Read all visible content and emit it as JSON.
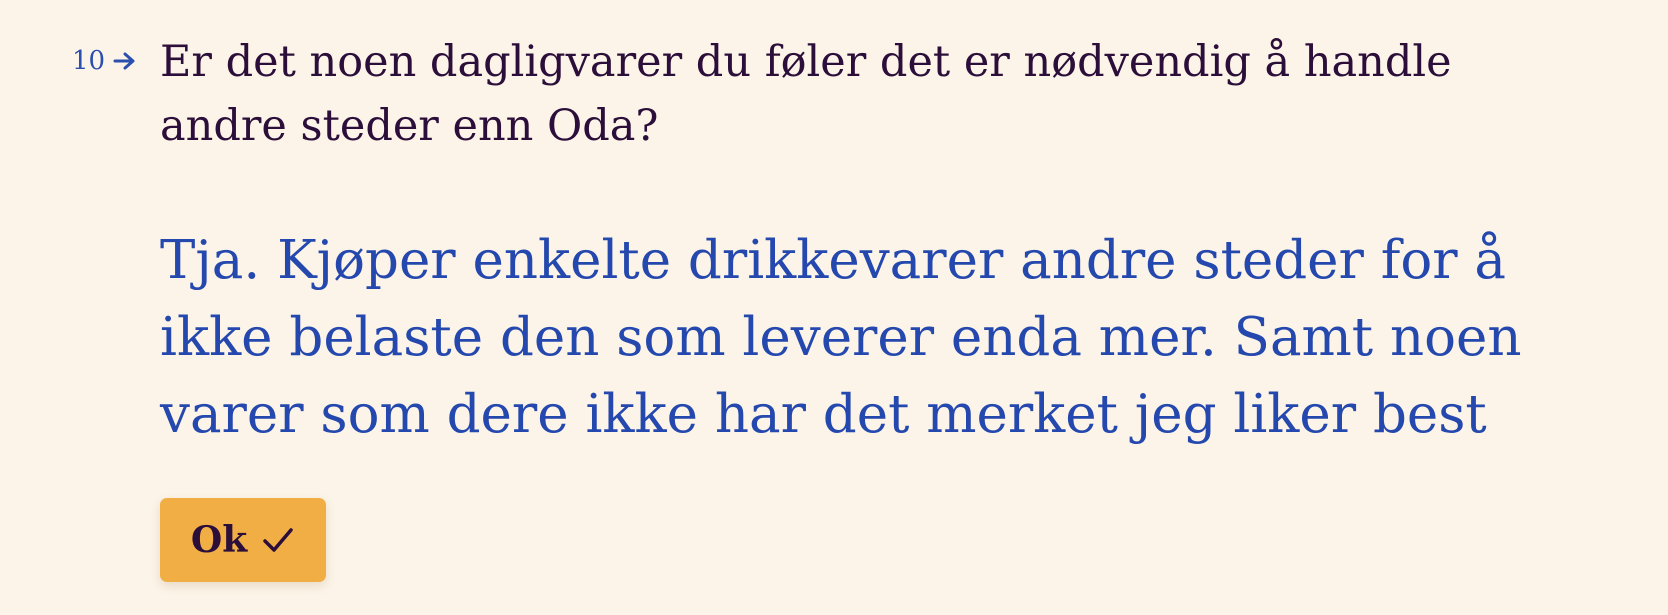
{
  "question": {
    "number": "10",
    "text": "Er det noen dagligvarer du føler det er nødvendig å handle andre steder enn Oda?",
    "number_icon": "arrow-right-icon"
  },
  "answer": {
    "value": "Tja. Kjøper enkelte drikkevarer andre steder for å ikke belaste den som leverer enda mer. Samt noen varer som dere ikke har det merket jeg liker best"
  },
  "submit": {
    "label": "Ok",
    "icon": "checkmark-icon"
  },
  "colors": {
    "background": "#fcf4e8",
    "question_text": "#2b0f3a",
    "answer_text": "#2448ad",
    "button": "#f1ae45"
  }
}
